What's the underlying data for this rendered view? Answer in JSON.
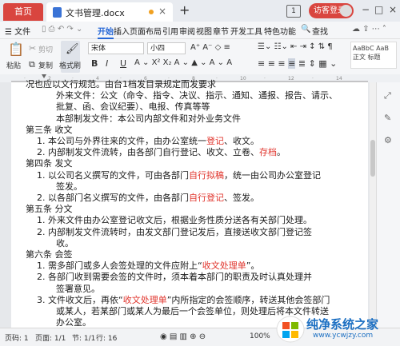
{
  "titlebar": {
    "home_tab": "首页",
    "doc_tab": "文书管理.docx",
    "close_glyph": "×",
    "new_tab_glyph": "+",
    "window_badge": "1",
    "login_button": "访客登录",
    "minimize": "−",
    "maximize": "□",
    "close": "×"
  },
  "menubar": {
    "file": "☰ 文件",
    "items": [
      "开始",
      "插入",
      "页面布局",
      "引用",
      "审阅",
      "视图",
      "章节",
      "开发工具",
      "特色功能"
    ],
    "active": "开始",
    "search": "查找"
  },
  "toolbar": {
    "paste": "粘贴",
    "cut": "剪切",
    "copy": "复制",
    "format_painter": "格式刷",
    "font_name": "宋体",
    "font_size": "小四",
    "bold": "B",
    "italic": "I",
    "underline": "U"
  },
  "document": {
    "lines": [
      {
        "text": "况也应以文行规范。由台1档发目录规定而发要求",
        "indent": 0
      },
      {
        "text": "外来文件：公文（命令、指令、决议、指示、通知、通报、报告、请示、",
        "indent": 1
      },
      {
        "text": "批复、函、会议纪要）、电报、传真等等",
        "indent": 1
      },
      {
        "text": "本部制发文件：本公司内部文件和对外业务文件",
        "indent": 1
      },
      {
        "text": "第三条  收文",
        "indent": 0
      },
      {
        "parts": [
          {
            "t": "1.  本公司与外界往来的文件，由办公室统一"
          },
          {
            "t": "登记",
            "red": true
          },
          {
            "t": "、收文。"
          }
        ],
        "indent": 2
      },
      {
        "parts": [
          {
            "t": "2.  内部制发文件流转，由各部门自行登记、收文、立卷、"
          },
          {
            "t": "存档",
            "red": true
          },
          {
            "t": "。"
          }
        ],
        "indent": 2
      },
      {
        "text": "第四条  发文",
        "indent": 0
      },
      {
        "parts": [
          {
            "t": "1.  以公司名义撰写的文件，可由各部门"
          },
          {
            "t": "自行拟稿",
            "red": true
          },
          {
            "t": "，统一由公司办公室登记"
          }
        ],
        "indent": 2
      },
      {
        "text": "签发。",
        "indent": 3
      },
      {
        "parts": [
          {
            "t": "2.  以各部门名义撰写的文件，由各部门"
          },
          {
            "t": "自行登记",
            "red": true
          },
          {
            "t": "、签发。"
          }
        ],
        "indent": 2
      },
      {
        "text": "第五条  分文",
        "indent": 0
      },
      {
        "text": "1.  外来文件由办公室登记收文后，根据业务性质分送各有关部门处理。",
        "indent": 2
      },
      {
        "text": "2.  内部制发文件流转时，由发文部门登记发后，直接送收文部门登记签",
        "indent": 2
      },
      {
        "text": "收。",
        "indent": 3
      },
      {
        "text": "第六条  会签",
        "indent": 0
      },
      {
        "parts": [
          {
            "t": "1.  需多部门或多人会签处理的文件应附上“"
          },
          {
            "t": "收文处理单",
            "red": true
          },
          {
            "t": "”。"
          }
        ],
        "indent": 2
      },
      {
        "text": "2.  各部门收到需要会签的文件时，须本着本部门的职责及时认真处理并",
        "indent": 2
      },
      {
        "text": "签署意见。",
        "indent": 3
      },
      {
        "parts": [
          {
            "t": "3.  文件收文后，再依“"
          },
          {
            "t": "收文处理单",
            "red": true
          },
          {
            "t": "”内所指定的会签顺序，转送其他会签部门"
          }
        ],
        "indent": 2
      },
      {
        "text": "或某人，若某部门或某人为最后一个会签单位，则处理后将本文件转送",
        "indent": 3
      },
      {
        "text": "办公室。",
        "indent": 3
      }
    ]
  },
  "statusbar": {
    "pages": "页码: 1",
    "page_of": "页面: 1/1",
    "section": "节: 1/1",
    "line": "行: 16",
    "zoom": "100%"
  },
  "watermark": {
    "title": "纯净系统之家",
    "url": "www.ycwjzy.com"
  }
}
